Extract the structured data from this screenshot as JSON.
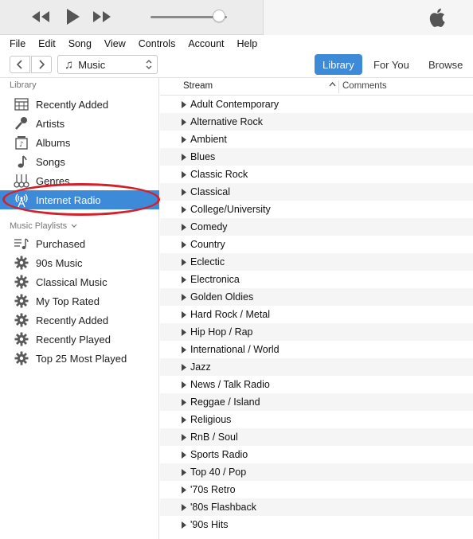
{
  "player": {
    "rewind_icon": "rewind-icon",
    "play_icon": "play-icon",
    "forward_icon": "fast-forward-icon",
    "volume_level": 0.9,
    "logo_icon": "apple-logo-icon"
  },
  "menu": [
    "File",
    "Edit",
    "Song",
    "View",
    "Controls",
    "Account",
    "Help"
  ],
  "toolbar": {
    "media_kind": "Music",
    "tabs": [
      "Library",
      "For You",
      "Browse"
    ],
    "active_tab": "Library"
  },
  "sidebar": {
    "library_heading": "Library",
    "library_items": [
      {
        "label": "Recently Added",
        "icon": "calendar-grid-icon"
      },
      {
        "label": "Artists",
        "icon": "microphone-icon"
      },
      {
        "label": "Albums",
        "icon": "album-stack-icon"
      },
      {
        "label": "Songs",
        "icon": "music-note-icon"
      },
      {
        "label": "Genres",
        "icon": "guitars-icon"
      },
      {
        "label": "Internet Radio",
        "icon": "radio-antenna-icon",
        "selected": true
      }
    ],
    "playlists_heading": "Music Playlists",
    "playlist_items": [
      {
        "label": "Purchased",
        "icon": "purchased-list-icon"
      },
      {
        "label": "90s Music",
        "icon": "gear-icon"
      },
      {
        "label": "Classical Music",
        "icon": "gear-icon"
      },
      {
        "label": "My Top Rated",
        "icon": "gear-icon"
      },
      {
        "label": "Recently Added",
        "icon": "gear-icon"
      },
      {
        "label": "Recently Played",
        "icon": "gear-icon"
      },
      {
        "label": "Top 25 Most Played",
        "icon": "gear-icon"
      }
    ]
  },
  "list": {
    "column_stream": "Stream",
    "column_comments": "Comments",
    "rows": [
      "Adult Contemporary",
      "Alternative Rock",
      "Ambient",
      "Blues",
      "Classic Rock",
      "Classical",
      "College/University",
      "Comedy",
      "Country",
      "Eclectic",
      "Electronica",
      "Golden Oldies",
      "Hard Rock / Metal",
      "Hip Hop / Rap",
      "International / World",
      "Jazz",
      "News / Talk Radio",
      "Reggae / Island",
      "Religious",
      "RnB / Soul",
      "Sports Radio",
      "Top 40 / Pop",
      "'70s Retro",
      "'80s Flashback",
      "'90s Hits"
    ]
  },
  "colors": {
    "accent": "#3d8ad9",
    "highlight_circle": "#d3202a"
  }
}
